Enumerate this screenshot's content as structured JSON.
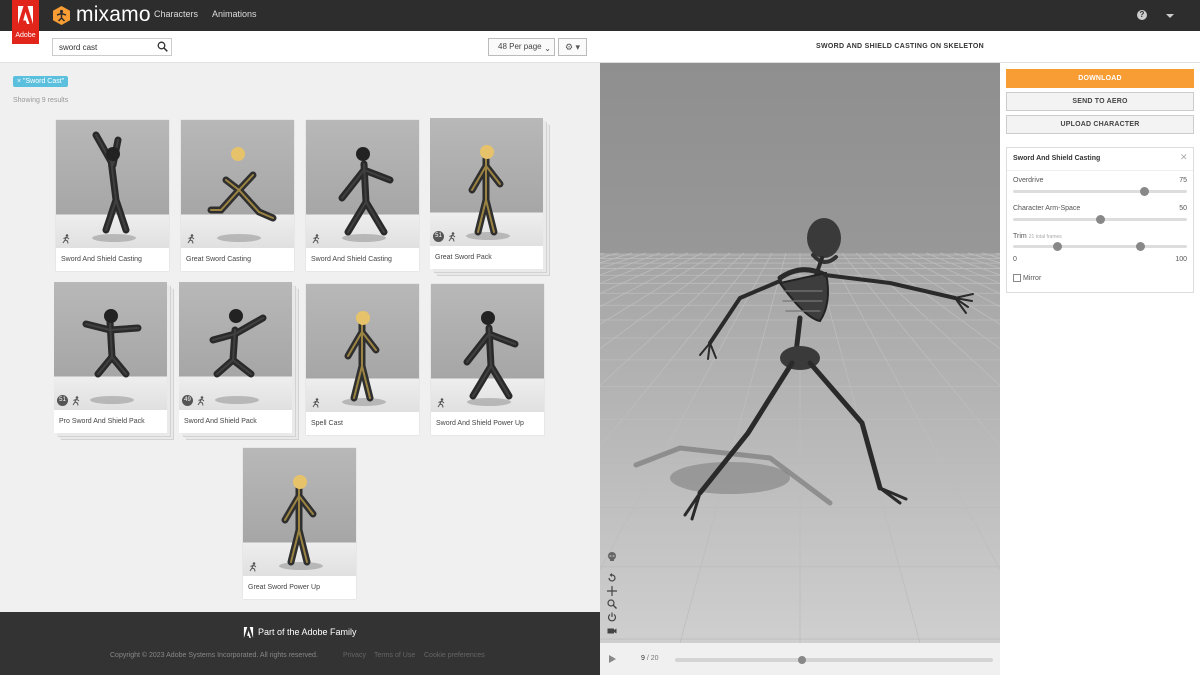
{
  "header": {
    "adobe_label": "Adobe",
    "brand": "mixamo",
    "nav": [
      "Characters",
      "Animations"
    ],
    "help": "?"
  },
  "search": {
    "value": "sword cast",
    "per_page": "48 Per page",
    "settings_glyph": "⚙ ▾"
  },
  "filters": {
    "tag": "× \"Sword Cast\"",
    "results": "Showing 9 results"
  },
  "cards": [
    {
      "label": "Sword And Shield Casting",
      "count": "",
      "character": "knight",
      "pose": "overhead"
    },
    {
      "label": "Great Sword Casting",
      "count": "",
      "character": "blonde",
      "pose": "kneel"
    },
    {
      "label": "Sword And Shield Casting",
      "count": "",
      "character": "knight",
      "pose": "stance"
    },
    {
      "label": "Great Sword Pack",
      "count": "51",
      "character": "blonde",
      "pose": "stand"
    },
    {
      "label": "Pro Sword And Shield Pack",
      "count": "51",
      "character": "knight",
      "pose": "jump"
    },
    {
      "label": "Sword And Shield Pack",
      "count": "49",
      "character": "knight",
      "pose": "crouch"
    },
    {
      "label": "Spell Cast",
      "count": "",
      "character": "blonde",
      "pose": "stand"
    },
    {
      "label": "Sword And Shield Power Up",
      "count": "",
      "character": "knight",
      "pose": "stance"
    },
    {
      "label": "Great Sword Power Up",
      "count": "",
      "character": "blonde",
      "pose": "stand"
    }
  ],
  "footer": {
    "title": "Part of the Adobe Family",
    "copyright": "Copyright © 2023 Adobe Systems Incorporated. All rights reserved.",
    "links": [
      "Privacy",
      "Terms of Use",
      "Cookie preferences"
    ]
  },
  "viewer": {
    "title": "SWORD AND SHIELD CASTING ON SKELETON",
    "frame_current": "9",
    "frame_total": "/ 20",
    "frame_fraction": 0.4,
    "tools": [
      "skull-icon",
      "reset-icon",
      "move-icon",
      "zoom-icon",
      "power-icon",
      "camera-icon"
    ]
  },
  "actions": {
    "download": "DOWNLOAD",
    "send_to_aero": "SEND TO AERO",
    "upload_character": "UPLOAD CHARACTER"
  },
  "settings": {
    "title": "Sword And Shield Casting",
    "overdrive": {
      "label": "Overdrive",
      "value": 75,
      "display": "75"
    },
    "arm_space": {
      "label": "Character Arm-Space",
      "value": 50,
      "display": "50"
    },
    "trim": {
      "label": "Trim",
      "sub": "21 total frames",
      "start": 0,
      "end": 100,
      "start_display": "0",
      "end_display": "100"
    },
    "mirror": {
      "label": "Mirror",
      "checked": false
    }
  },
  "colors": {
    "accent": "#f89c34",
    "tag": "#5bc0de",
    "nav": "#2d2d2d",
    "adobe": "#e1251b"
  }
}
